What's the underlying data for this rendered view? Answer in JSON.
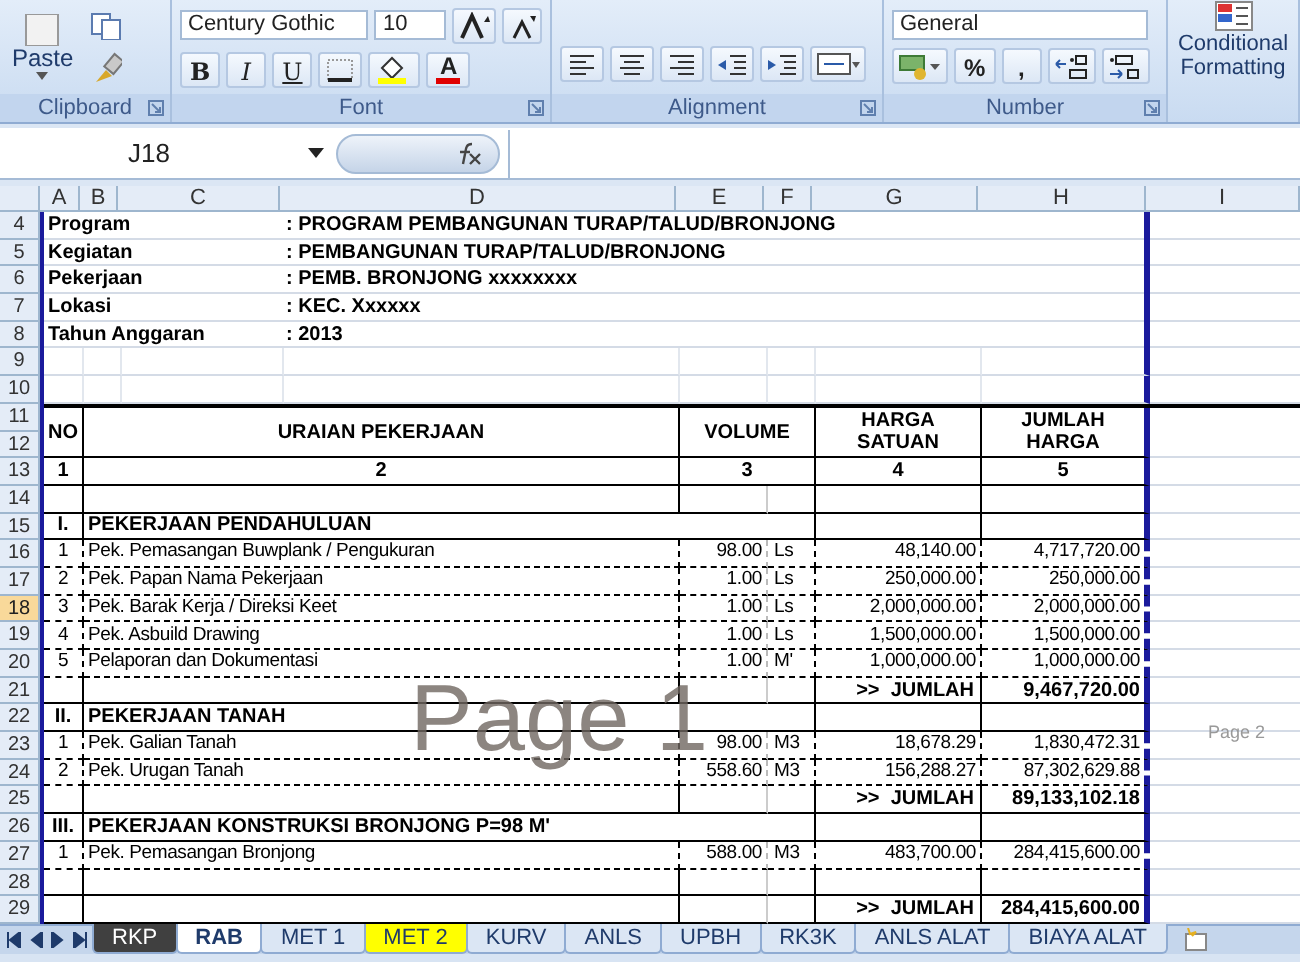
{
  "ribbon": {
    "groups": [
      {
        "kind": "clipboard",
        "label": "Clipboard",
        "paste": "Paste"
      },
      {
        "kind": "font",
        "label": "Font",
        "font_name": "Century Gothic",
        "font_size": "10",
        "format_buttons": [
          "B",
          "I",
          "U"
        ],
        "font_color": "A"
      },
      {
        "kind": "alignment",
        "label": "Alignment"
      },
      {
        "kind": "number",
        "label": "Number",
        "number_format": "General",
        "buttons": [
          "%",
          ","
        ]
      },
      {
        "kind": "styles",
        "button": "Conditional Formatting"
      }
    ]
  },
  "formula_bar": {
    "name_box": "J18"
  },
  "column_headers": [
    "A",
    "B",
    "C",
    "D",
    "E",
    "F",
    "G",
    "H",
    "I"
  ],
  "row_headers": [
    {
      "label": "4",
      "selected": false
    },
    {
      "label": "5",
      "selected": false
    },
    {
      "label": "6",
      "selected": false
    },
    {
      "label": "7",
      "selected": false
    },
    {
      "label": "8",
      "selected": false
    },
    {
      "label": "9",
      "selected": false
    },
    {
      "label": "10",
      "selected": false
    },
    {
      "label": "11",
      "selected": false
    },
    {
      "label": "12",
      "selected": false
    },
    {
      "label": "13",
      "selected": false
    },
    {
      "label": "14",
      "selected": false
    },
    {
      "label": "15",
      "selected": false
    },
    {
      "label": "16",
      "selected": false
    },
    {
      "label": "17",
      "selected": false
    },
    {
      "label": "18",
      "selected": true
    },
    {
      "label": "19",
      "selected": false
    },
    {
      "label": "20",
      "selected": false
    },
    {
      "label": "21",
      "selected": false
    },
    {
      "label": "22",
      "selected": false
    },
    {
      "label": "23",
      "selected": false
    },
    {
      "label": "24",
      "selected": false
    },
    {
      "label": "25",
      "selected": false
    },
    {
      "label": "26",
      "selected": false
    },
    {
      "label": "27",
      "selected": false
    },
    {
      "label": "28",
      "selected": false
    },
    {
      "label": "29",
      "selected": false
    }
  ],
  "rows": [
    {
      "kind": "info",
      "label": "Program",
      "value": ": PROGRAM PEMBANGUNAN TURAP/TALUD/BRONJONG"
    },
    {
      "kind": "info",
      "label": "Kegiatan",
      "value": ": PEMBANGUNAN TURAP/TALUD/BRONJONG"
    },
    {
      "kind": "info",
      "label": "Pekerjaan",
      "value": ": PEMB. BRONJONG xxxxxxxx"
    },
    {
      "kind": "info",
      "label": "Lokasi",
      "value": ": KEC. Xxxxxx"
    },
    {
      "kind": "info",
      "label": "Tahun Anggaran",
      "value": ": 2013"
    },
    {
      "kind": "blank"
    },
    {
      "kind": "blank"
    },
    {
      "kind": "table_header",
      "no": "NO",
      "description": "URAIAN PEKERJAAN",
      "volume": "VOLUME",
      "price": "HARGA SATUAN",
      "amount": "JUMLAH HARGA"
    },
    {
      "kind": "column_numbers",
      "no": "1",
      "description": "2",
      "volume": "3",
      "price": "4",
      "amount": "5"
    },
    {
      "kind": "table_blank"
    },
    {
      "kind": "section",
      "no": "I.",
      "title": "PEKERJAAN PENDAHULUAN"
    },
    {
      "kind": "item",
      "no": "1",
      "description": "Pek. Pemasangan Buwplank / Pengukuran",
      "volume": "98.00",
      "unit": "Ls",
      "price": "48,140.00",
      "amount": "4,717,720.00"
    },
    {
      "kind": "item",
      "no": "2",
      "description": "Pek. Papan Nama Pekerjaan",
      "volume": "1.00",
      "unit": "Ls",
      "price": "250,000.00",
      "amount": "250,000.00"
    },
    {
      "kind": "item",
      "no": "3",
      "description": "Pek. Barak Kerja / Direksi Keet",
      "volume": "1.00",
      "unit": "Ls",
      "price": "2,000,000.00",
      "amount": "2,000,000.00"
    },
    {
      "kind": "item",
      "no": "4",
      "description": "Pek. Asbuild Drawing",
      "volume": "1.00",
      "unit": "Ls",
      "price": "1,500,000.00",
      "amount": "1,500,000.00"
    },
    {
      "kind": "item",
      "no": "5",
      "description": "Pelaporan dan Dokumentasi",
      "volume": "1.00",
      "unit": "M'",
      "price": "1,000,000.00",
      "amount": "1,000,000.00"
    },
    {
      "kind": "total",
      "label": ">>  JUMLAH",
      "amount": "9,467,720.00"
    },
    {
      "kind": "section",
      "no": "II.",
      "title": "PEKERJAAN TANAH"
    },
    {
      "kind": "item",
      "no": "1",
      "description": "Pek. Galian Tanah",
      "volume": "98.00",
      "unit": "M3",
      "price": "18,678.29",
      "amount": "1,830,472.31"
    },
    {
      "kind": "item",
      "no": "2",
      "description": "Pek. Urugan Tanah",
      "volume": "558.60",
      "unit": "M3",
      "price": "156,288.27",
      "amount": "87,302,629.88"
    },
    {
      "kind": "total",
      "label": ">>  JUMLAH",
      "amount": "89,133,102.18"
    },
    {
      "kind": "section",
      "no": "III.",
      "title": "PEKERJAAN KONSTRUKSI BRONJONG P=98 M'"
    },
    {
      "kind": "item",
      "no": "1",
      "description": "Pek. Pemasangan Bronjong",
      "volume": "588.00",
      "unit": "M3",
      "price": "483,700.00",
      "amount": "284,415,600.00"
    },
    {
      "kind": "table_blank"
    },
    {
      "kind": "total",
      "label": ">>  JUMLAH",
      "amount": "284,415,600.00"
    }
  ],
  "page_labels": [
    "Page 1",
    "Page 2"
  ],
  "sheet_tabs": [
    {
      "label": "RKP",
      "selected": false,
      "color": "#404040"
    },
    {
      "label": "RAB",
      "selected": true
    },
    {
      "label": "MET 1",
      "selected": false
    },
    {
      "label": "MET 2",
      "selected": false,
      "color": "#ffff00"
    },
    {
      "label": "KURV",
      "selected": false
    },
    {
      "label": "ANLS",
      "selected": false
    },
    {
      "label": "UPBH",
      "selected": false
    },
    {
      "label": "RK3K",
      "selected": false
    },
    {
      "label": "ANLS ALAT",
      "selected": false
    },
    {
      "label": "BIAYA ALAT",
      "selected": false
    }
  ]
}
